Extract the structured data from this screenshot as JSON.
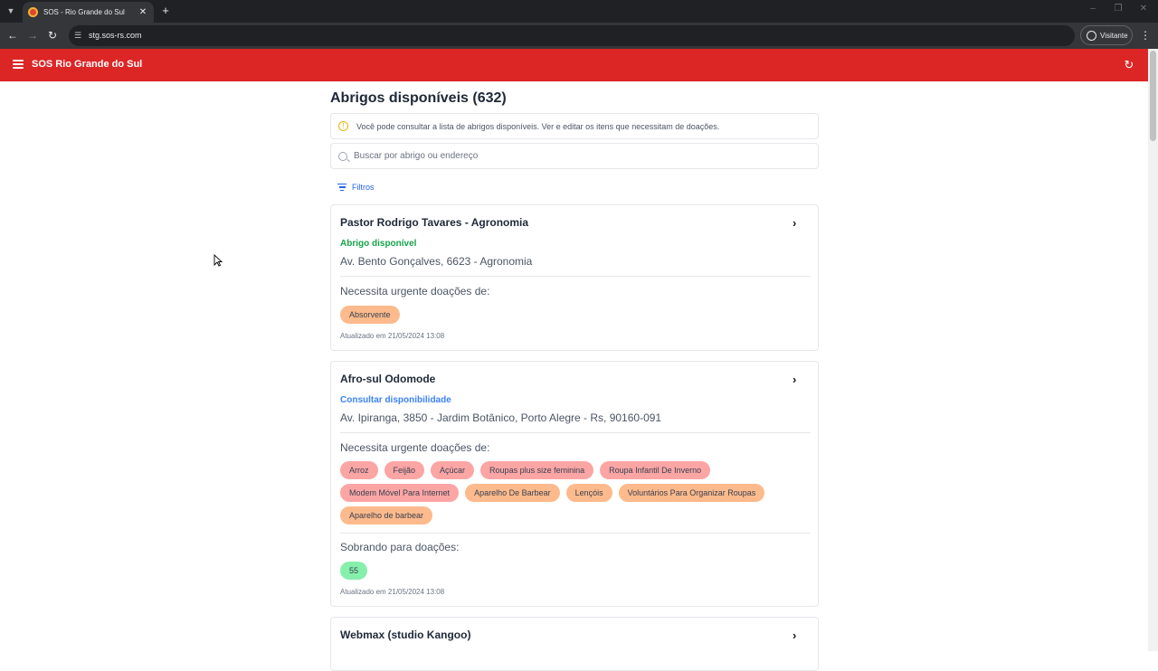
{
  "browser": {
    "tab_title": "SOS - Rio Grande do Sul",
    "url": "stg.sos-rs.com",
    "profile_label": "Visitante",
    "icons": [
      "tab-list-icon",
      "close-icon",
      "plus-icon",
      "back-icon",
      "forward-icon",
      "reload-icon",
      "site-info-icon",
      "profile-icon",
      "menu-icon"
    ]
  },
  "header": {
    "title": "SOS Rio Grande do Sul",
    "accent_color": "#dc2626"
  },
  "main": {
    "title": "Abrigos disponíveis (632)",
    "info_text": "Você pode consultar a lista de abrigos disponíveis. Ver e editar os itens que necessitam de doações.",
    "search_placeholder": "Buscar por abrigo ou endereço",
    "filters_label": "Filtros"
  },
  "shelters": [
    {
      "name": "Pastor Rodrigo Tavares - Agronomia",
      "status": "Abrigo disponível",
      "status_color": "#16a34a",
      "address": "Av. Bento Gonçalves, 6623 - Agronomia",
      "urgent_label": "Necessita urgente doações de:",
      "urgent": [
        {
          "label": "Absorvente",
          "tone": "orange"
        }
      ],
      "updated": "Atualizado em 21/05/2024 13:08"
    },
    {
      "name": "Afro-sul Odomode",
      "status": "Consultar disponibilidade",
      "status_color": "#3b82f6",
      "address": "Av. Ipiranga, 3850 - Jardim Botânico, Porto Alegre - Rs, 90160-091",
      "urgent_label": "Necessita urgente doações de:",
      "urgent": [
        {
          "label": "Arroz",
          "tone": "red"
        },
        {
          "label": "Feijão",
          "tone": "red"
        },
        {
          "label": "Açúcar",
          "tone": "red"
        },
        {
          "label": "Roupas plus size feminina",
          "tone": "red"
        },
        {
          "label": "Roupa Infantil De Inverno",
          "tone": "red"
        },
        {
          "label": "Modem Móvel Para Internet",
          "tone": "red"
        },
        {
          "label": "Aparelho De Barbear",
          "tone": "orange"
        },
        {
          "label": "Lençóis",
          "tone": "orange"
        },
        {
          "label": "Voluntários Para Organizar Roupas",
          "tone": "orange"
        },
        {
          "label": "Aparelho de barbear",
          "tone": "orange"
        }
      ],
      "surplus_label": "Sobrando para doações:",
      "surplus": [
        {
          "label": "55",
          "tone": "green"
        }
      ],
      "updated": "Atualizado em 21/05/2024 13:08"
    },
    {
      "name": "Webmax (studio Kangoo)"
    }
  ]
}
